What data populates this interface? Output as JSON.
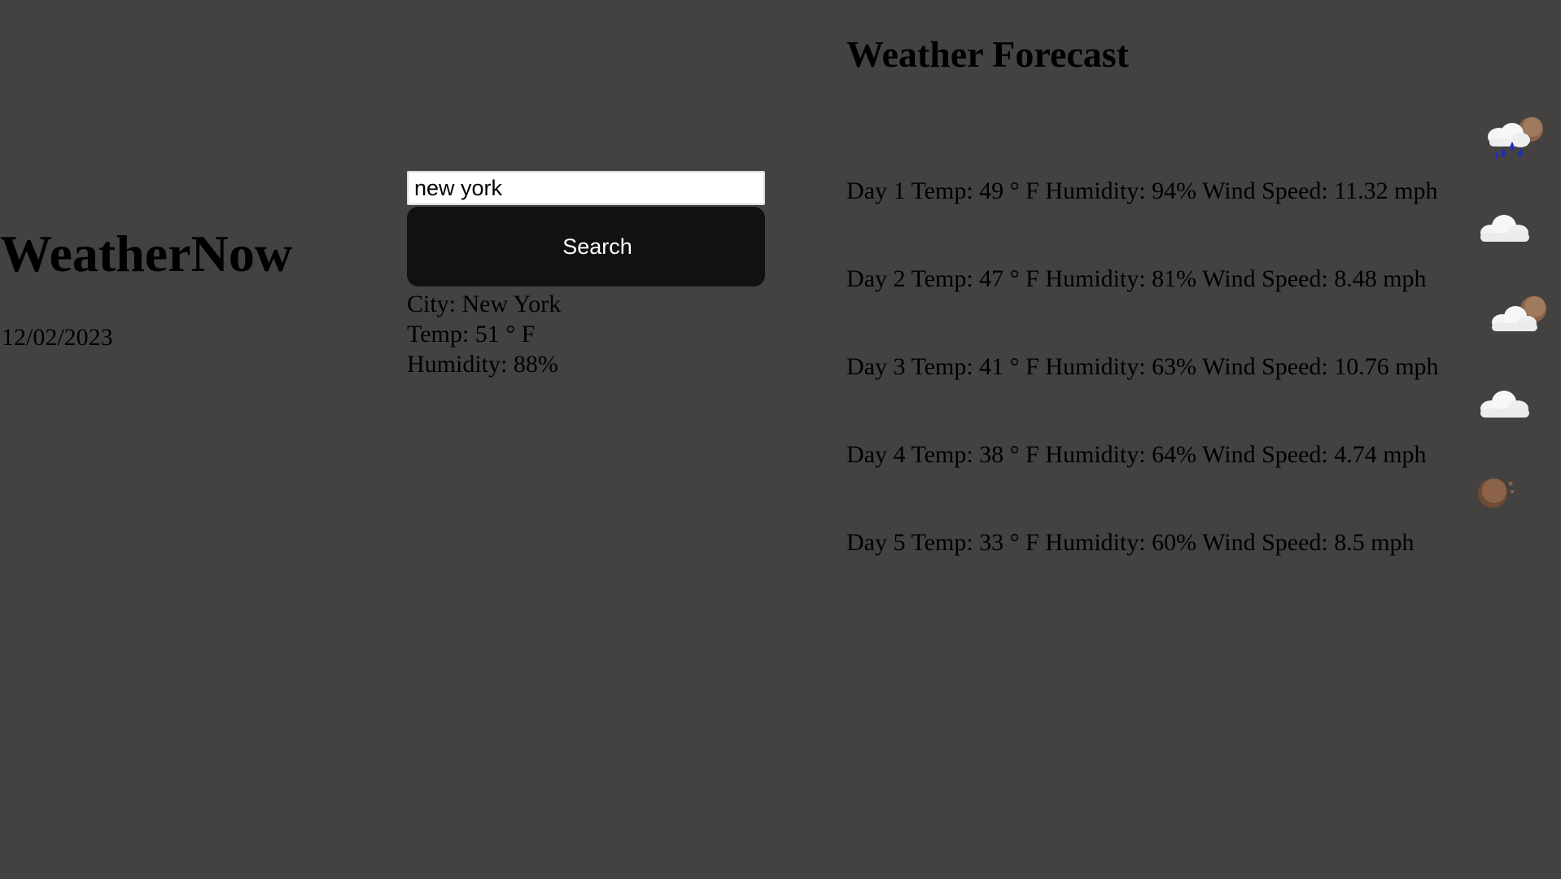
{
  "app": {
    "title": "WeatherNow",
    "date": "12/02/2023"
  },
  "search": {
    "value": "new york",
    "button_label": "Search"
  },
  "current": {
    "city": "City: New York",
    "temp": "Temp: 51 ° F",
    "humidity": "Humidity: 88%"
  },
  "forecast": {
    "title": "Weather Forecast",
    "days": [
      {
        "text": "Day 1 Temp: 49 ° F Humidity: 94% Wind Speed: 11.32 mph",
        "icon": "rain-icon"
      },
      {
        "text": "Day 2 Temp: 47 ° F Humidity: 81% Wind Speed: 8.48 mph",
        "icon": "cloud-icon"
      },
      {
        "text": "Day 3 Temp: 41 ° F Humidity: 63% Wind Speed: 10.76 mph",
        "icon": "partly-cloudy-night-icon"
      },
      {
        "text": "Day 4 Temp: 38 ° F Humidity: 64% Wind Speed: 4.74 mph",
        "icon": "cloud-icon"
      },
      {
        "text": "Day 5 Temp: 33 ° F Humidity: 60% Wind Speed: 8.5 mph",
        "icon": "clear-night-icon"
      }
    ]
  },
  "colors": {
    "background": "#434241",
    "button": "#111111",
    "text": "#000000"
  }
}
